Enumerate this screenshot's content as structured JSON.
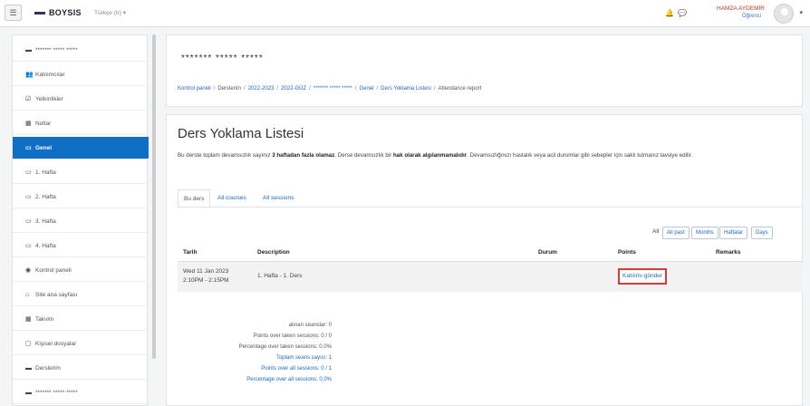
{
  "navbar": {
    "menu_icon": "hamburger-icon",
    "brand": "BOYSIS",
    "language": "Türkçe (tr) ▾",
    "user_name": "HAMZA AYDEMİR",
    "user_role": "Öğrenci",
    "caret": "▾"
  },
  "sidebar": {
    "items": [
      {
        "label": "******* ***** *****",
        "icon": "graduation-cap-icon",
        "glyph": "▬"
      },
      {
        "label": "Katılımcılar",
        "icon": "users-icon",
        "glyph": "👥"
      },
      {
        "label": "Yetkinlikler",
        "icon": "badge-check-icon",
        "glyph": "☑"
      },
      {
        "label": "Notlar",
        "icon": "table-icon",
        "glyph": "▦"
      },
      {
        "label": "Genel",
        "icon": "folder-icon",
        "glyph": "▭"
      },
      {
        "label": "1. Hafta",
        "icon": "folder-icon",
        "glyph": "▭"
      },
      {
        "label": "2. Hafta",
        "icon": "folder-icon",
        "glyph": "▭"
      },
      {
        "label": "3. Hafta",
        "icon": "folder-icon",
        "glyph": "▭"
      },
      {
        "label": "4. Hafta",
        "icon": "folder-icon",
        "glyph": "▭"
      },
      {
        "label": "Kontrol paneli",
        "icon": "dashboard-icon",
        "glyph": "◉"
      },
      {
        "label": "Site ana sayfası",
        "icon": "home-icon",
        "glyph": "⌂"
      },
      {
        "label": "Takvim",
        "icon": "calendar-icon",
        "glyph": "▦"
      },
      {
        "label": "Kişisel dosyalar",
        "icon": "file-icon",
        "glyph": "▢"
      },
      {
        "label": "Derslerim",
        "icon": "graduation-cap-icon",
        "glyph": "▬"
      },
      {
        "label": "******* ***** *****",
        "icon": "graduation-cap-icon",
        "glyph": "▬"
      }
    ]
  },
  "header": {
    "course_title": "******* ***** *****",
    "breadcrumb": [
      {
        "label": "Kontrol paneli",
        "link": true
      },
      {
        "label": "Derslerim",
        "link": false
      },
      {
        "label": "2022-2023",
        "link": true
      },
      {
        "label": "2022-GÜZ",
        "link": true
      },
      {
        "label": "******* ***** *****",
        "link": true
      },
      {
        "label": "Genel",
        "link": true
      },
      {
        "label": "Ders Yoklama Listesi",
        "link": true
      },
      {
        "label": "Attendance report",
        "link": false
      }
    ],
    "separator": "/"
  },
  "main": {
    "title": "Ders Yoklama Listesi",
    "notice_1": "Bu derste toplam devamsızlık sayınız ",
    "notice_b1": "3 haftadan fazla olamaz",
    "notice_2": ". Derse devamsızlık bir ",
    "notice_b2": "hak olarak algılanmamalıdır",
    "notice_3": ". Devamsızlığınızı hastalık veya acil durumlar gibi sebepler için saklı tutmanız tavsiye edilir.",
    "tabs": [
      "Bu ders",
      "All courses",
      "All sessions"
    ],
    "filter_label": "All",
    "filter_buttons": [
      "All past",
      "Months",
      "Haftalar",
      "Days"
    ],
    "table": {
      "headers": [
        "Tarih",
        "Description",
        "Durum",
        "Points",
        "Remarks"
      ],
      "row": {
        "date_line1": "Wed 11 Jan 2023",
        "date_line2": "2:10PM - 2:15PM",
        "description": "1. Hafta - 1. Ders",
        "status": "",
        "points_link": "Katılımı gönder",
        "remarks": ""
      }
    },
    "stats": [
      {
        "label": "alınan seanslar: 0",
        "link": false
      },
      {
        "label": "Points over taken sessions: 0 / 0",
        "link": false
      },
      {
        "label": "Percentage over taken sessions: 0,0%",
        "link": false
      },
      {
        "label": "Toplam seans sayısı: 1",
        "link": true
      },
      {
        "label": "Points over all sessions: 0 / 1",
        "link": true
      },
      {
        "label": "Percentage over all sessions: 0,0%",
        "link": true
      }
    ]
  },
  "colors": {
    "accent": "#0f6fc5",
    "link": "#1e67c2",
    "highlight_border": "#d63a3a"
  }
}
